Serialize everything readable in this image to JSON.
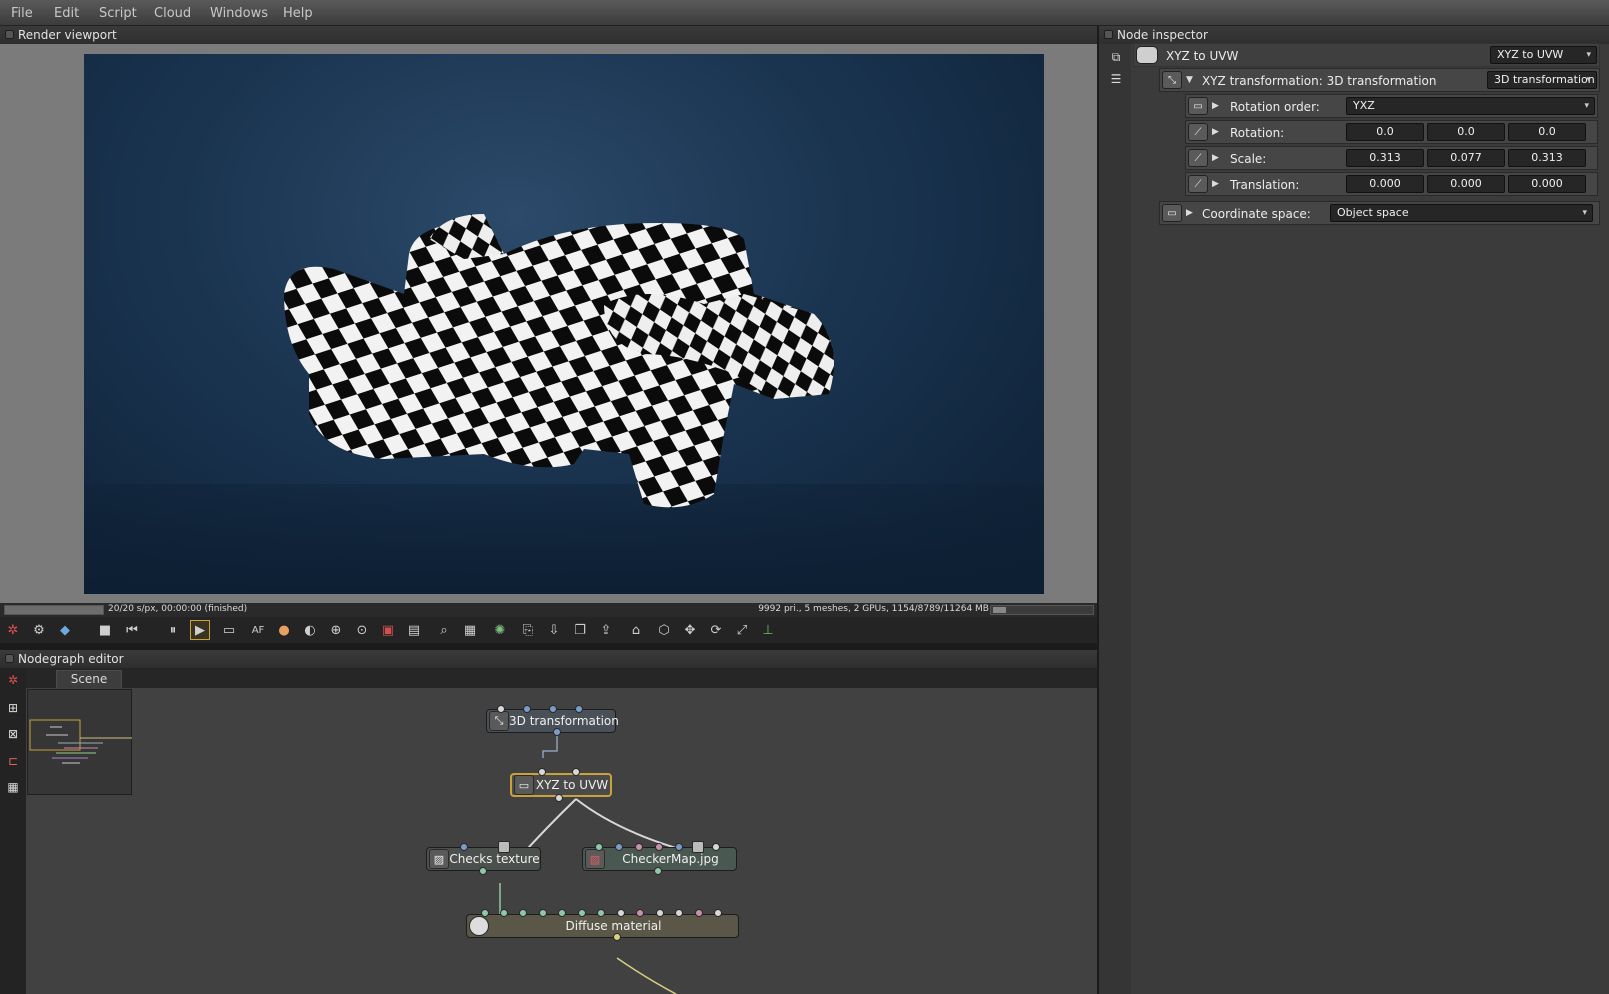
{
  "menu": [
    "File",
    "Edit",
    "Script",
    "Cloud",
    "Windows",
    "Help"
  ],
  "viewport": {
    "title": "Render viewport",
    "progress": 1.0,
    "status_left": "20/20 s/px, 00:00:00 (finished)",
    "status_right": "9992 pri., 5 meshes, 2 GPUs, 1154/8789/11264 MB",
    "memory_fraction": 0.13
  },
  "toolbar_icons": [
    "octane-logo-icon",
    "settings-icon",
    "cube-color-icon",
    "stop-icon",
    "rewind-icon",
    "pause-icon",
    "play-icon",
    "display-icon",
    "af-icon",
    "color-wheel-icon",
    "sphere-icon",
    "pick-focus-icon",
    "pick-white-icon",
    "pick-material-icon",
    "pick-object-icon",
    "zoom-region-icon",
    "region-icon",
    "film-region-icon",
    "copy-icon",
    "save-icon",
    "layers-icon",
    "export-icon",
    "lock-icon",
    "box-icon",
    "move-icon",
    "rotate-icon",
    "fullscreen-icon",
    "axis-icon"
  ],
  "nodegraph": {
    "title": "Nodegraph editor",
    "tab": "Scene",
    "nodes": {
      "transform": "3D transformation",
      "xyz": "XYZ to UVW",
      "checks": "Checks texture",
      "checkermap": "CheckerMap.jpg",
      "diffuse": "Diffuse material"
    }
  },
  "inspector": {
    "title": "Node inspector",
    "node_name": "XYZ to UVW",
    "node_type": "XYZ to UVW",
    "transform_label": "XYZ transformation: 3D transformation",
    "transform_type": "3D transformation",
    "rotation_order_label": "Rotation order:",
    "rotation_order": "YXZ",
    "rotation_label": "Rotation:",
    "rotation": [
      "0.0",
      "0.0",
      "0.0"
    ],
    "scale_label": "Scale:",
    "scale": [
      "0.313",
      "0.077",
      "0.313"
    ],
    "translation_label": "Translation:",
    "translation": [
      "0.000",
      "0.000",
      "0.000"
    ],
    "coord_label": "Coordinate space:",
    "coord_space": "Object space"
  },
  "colors": {
    "selected_node_border": "#c9a23a",
    "pin_blue": "#7a9cc8",
    "pin_green": "#8fc8a8",
    "pin_pink": "#c890b0",
    "pin_white": "#d8d8d8"
  }
}
